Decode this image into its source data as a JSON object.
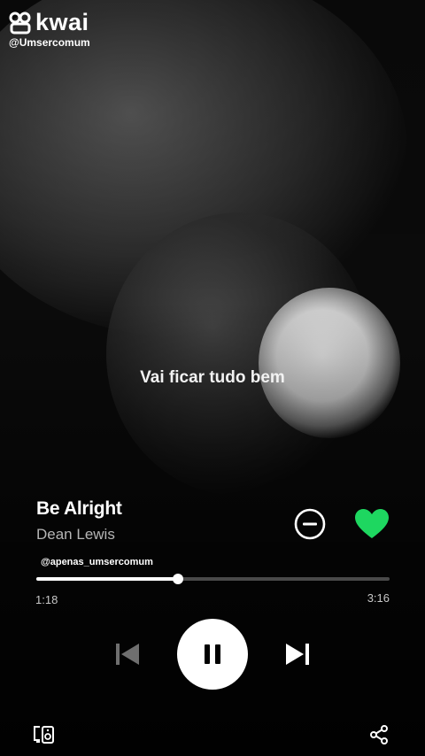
{
  "watermark": {
    "brand": "kwai",
    "handle": "@Umsercomum"
  },
  "lyric": "Vai ficar tudo bem",
  "track": {
    "title": "Be Alright",
    "artist": "Dean Lewis",
    "liked": true
  },
  "tag": "@apenas_umsercomum",
  "playback": {
    "elapsed": "1:18",
    "duration": "3:16",
    "progress": 0.402,
    "state": "playing"
  },
  "colors": {
    "accent_green": "#1ED760",
    "background": "#0b0b0b",
    "text_secondary": "#b5b5b5",
    "track_bg": "#4a4a4a"
  },
  "icons": {
    "remove": "minus-circle-icon",
    "like": "heart-icon",
    "prev": "skip-previous-icon",
    "pause": "pause-icon",
    "next": "skip-next-icon",
    "devices": "devices-icon",
    "share": "share-icon"
  }
}
